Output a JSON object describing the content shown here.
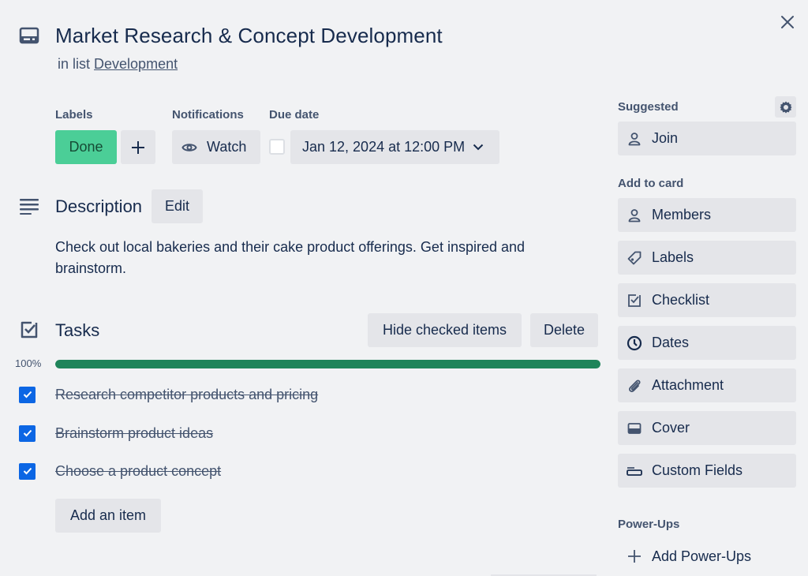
{
  "card": {
    "title": "Market Research & Concept Development",
    "in_list_prefix": "in list",
    "list_name": "Development"
  },
  "fields": {
    "labels_heading": "Labels",
    "label_done": "Done",
    "label_done_color": "#4bce97",
    "add_label": "+",
    "notifications_heading": "Notifications",
    "watch_label": "Watch",
    "due_heading": "Due date",
    "due_checked": false,
    "due_value": "Jan 12, 2024 at 12:00 PM"
  },
  "description": {
    "heading": "Description",
    "edit_label": "Edit",
    "text": "Check out local bakeries and their cake product offerings. Get inspired and brainstorm."
  },
  "tasks": {
    "heading": "Tasks",
    "hide_checked_label": "Hide checked items",
    "delete_label": "Delete",
    "progress_label": "100%",
    "progress_percent": 100,
    "progress_color": "#1f845a",
    "items": [
      {
        "text": "Research competitor products and pricing",
        "checked": true
      },
      {
        "text": "Brainstorm product ideas",
        "checked": true
      },
      {
        "text": "Choose a product concept",
        "checked": true
      }
    ],
    "add_item_label": "Add an item"
  },
  "sidebar": {
    "suggested_heading": "Suggested",
    "join_label": "Join",
    "add_to_card_heading": "Add to card",
    "add_to_card": [
      {
        "label": "Members",
        "icon": "person-icon"
      },
      {
        "label": "Labels",
        "icon": "tag-icon"
      },
      {
        "label": "Checklist",
        "icon": "checklist-icon"
      },
      {
        "label": "Dates",
        "icon": "clock-icon"
      },
      {
        "label": "Attachment",
        "icon": "paperclip-icon"
      },
      {
        "label": "Cover",
        "icon": "cover-icon"
      },
      {
        "label": "Custom Fields",
        "icon": "custom-fields-icon"
      }
    ],
    "powerups_heading": "Power-Ups",
    "add_powerups_label": "Add Power-Ups"
  }
}
